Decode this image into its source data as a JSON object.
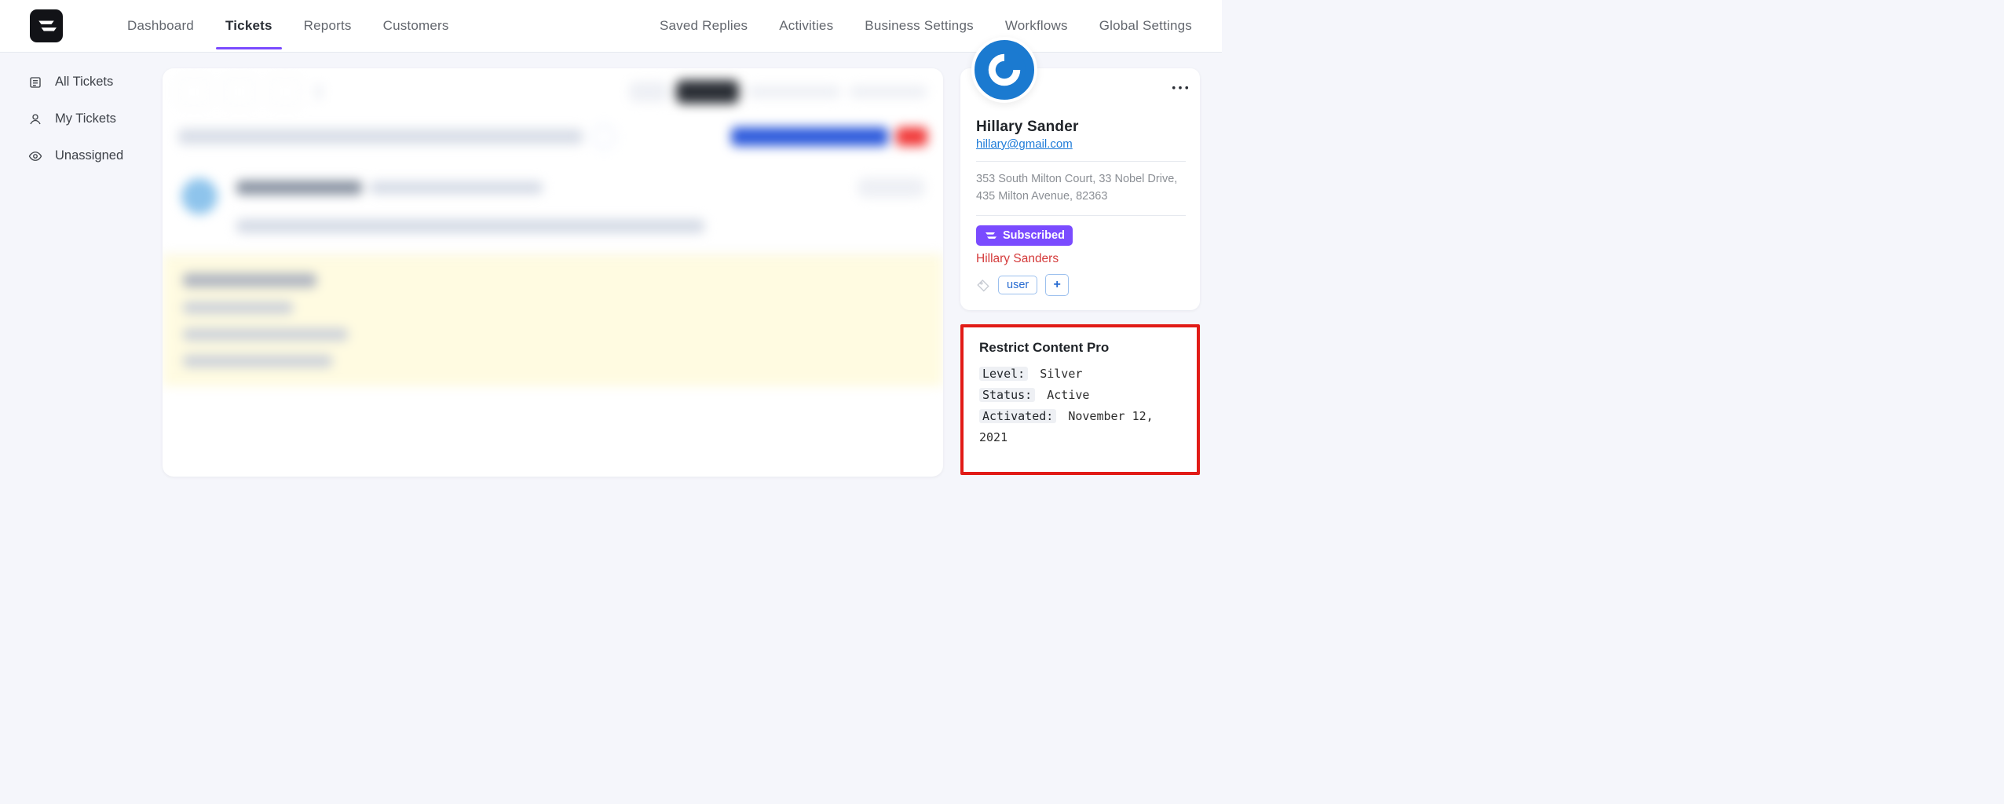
{
  "nav": {
    "dashboard": "Dashboard",
    "tickets": "Tickets",
    "reports": "Reports",
    "customers": "Customers",
    "saved_replies": "Saved Replies",
    "activities": "Activities",
    "business_settings": "Business Settings",
    "workflows": "Workflows",
    "global_settings": "Global Settings"
  },
  "sidebar": {
    "all": "All Tickets",
    "mine": "My Tickets",
    "unassigned": "Unassigned"
  },
  "profile": {
    "name": "Hillary Sander",
    "email": "hillary@gmail.com",
    "address": "353 South Milton Court, 33 Nobel Drive, 435 Milton Avenue, 82363",
    "subscribed_label": "Subscribed",
    "display_name": "Hillary Sanders",
    "tag": "user",
    "add_label": "+"
  },
  "rcp": {
    "title": "Restrict Content Pro",
    "level_k": "Level:",
    "level_v": "Silver",
    "status_k": "Status:",
    "status_v": "Active",
    "activated_k": "Activated:",
    "activated_v": "November 12, 2021"
  }
}
